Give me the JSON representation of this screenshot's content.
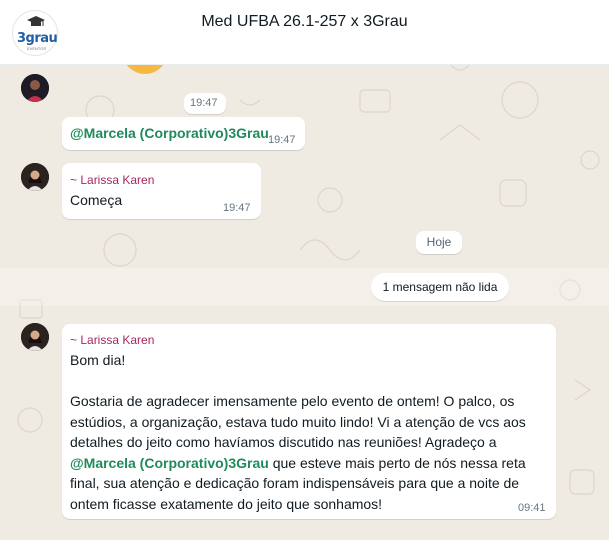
{
  "header": {
    "title": "Med UFBA 26.1-257 x 3Grau",
    "logo_text": "3grau",
    "logo_subtext": "EVENTOS"
  },
  "messages": [
    {
      "type": "time_only",
      "time": "19:47"
    },
    {
      "type": "mention",
      "mention": "@Marcela (Corporativo)3Grau",
      "time": "19:47"
    },
    {
      "type": "text",
      "sender": "~ Larissa Karen",
      "text": "Começa",
      "time": "19:47"
    }
  ],
  "date_separator": "Hoje",
  "unread_label": "1 mensagem não lida",
  "last_message": {
    "sender": "~ Larissa Karen",
    "greeting": "Bom dia!",
    "lines": [
      "Gostaria de agradecer imensamente pelo evento de ontem! O palco, os",
      "estúdios, a organização, estava tudo muito lindo! Vi a atenção de vcs aos",
      "detalhes do jeito como havíamos discutido nas reuniões! Agradeço a"
    ],
    "mention": "@Marcela (Corporativo)3Grau",
    "after_mention": " que esteve mais perto de nós nessa reta",
    "tail_lines": [
      "final, sua atenção e dedicação foram indispensáveis para que a noite de",
      "ontem ficasse exatamente do jeito que sonhamos!"
    ],
    "time": "09:41"
  },
  "colors": {
    "background": "#efeae2",
    "sender": "#a5285f",
    "mention": "#1f8a5c",
    "timestamp": "#667781"
  }
}
